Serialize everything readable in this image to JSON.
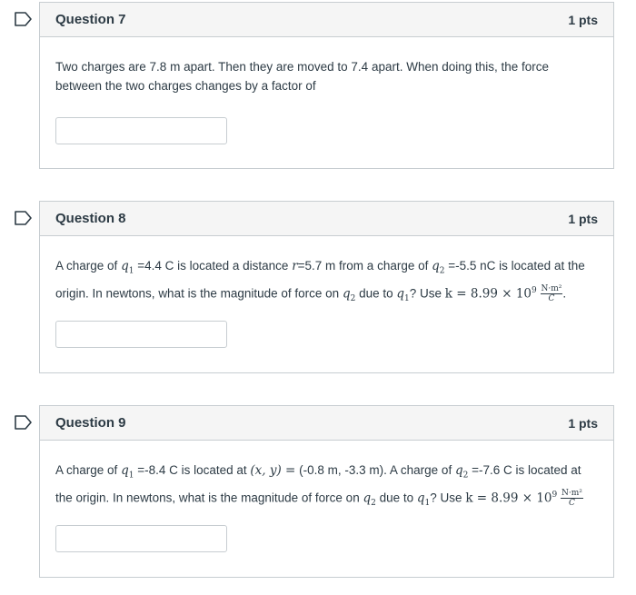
{
  "questions": [
    {
      "title": "Question 7",
      "points": "1 pts",
      "text": "Two charges are 7.8 m apart. Then they are moved to 7.4 apart. When doing this, the force between the two charges changes by a factor of"
    },
    {
      "title": "Question 8",
      "points": "1 pts",
      "p1": "A charge of ",
      "q1": "q",
      "q1_sub": "1",
      "p2": " =4.4 C is located a distance ",
      "r": "r",
      "p3": "=5.7 m from a charge of ",
      "q2": "q",
      "q2_sub": "2",
      "p4": " =-5.5 nC is located at the origin. In newtons, what is the magnitude of force on ",
      "p5": " due to ",
      "p6": "? Use ",
      "k_expr": "k = 8.99 × 10",
      "k_exp": "9",
      "unit_num": "N·m²",
      "unit_den": "C",
      "end": "."
    },
    {
      "title": "Question 9",
      "points": "1 pts",
      "p1": "A charge of ",
      "p2": " =-8.4 C is located at ",
      "xy": "(x, y) =",
      "p3": " (-0.8 m, -3.3 m). A charge of ",
      "p4": " =-7.6 C is located at the origin. In newtons, what is the magnitude of force on ",
      "p5": " due to ",
      "p6": "? Use ",
      "k_expr": "k = 8.99 × 10",
      "k_exp": "9",
      "unit_num": "N·m²",
      "unit_den": "C"
    }
  ],
  "colors": {
    "border": "#c7cdd1",
    "header_bg": "#f5f5f5",
    "text": "#2d3b45",
    "flag": "#2d3b45"
  },
  "icons": {
    "flag": "flag-icon"
  }
}
